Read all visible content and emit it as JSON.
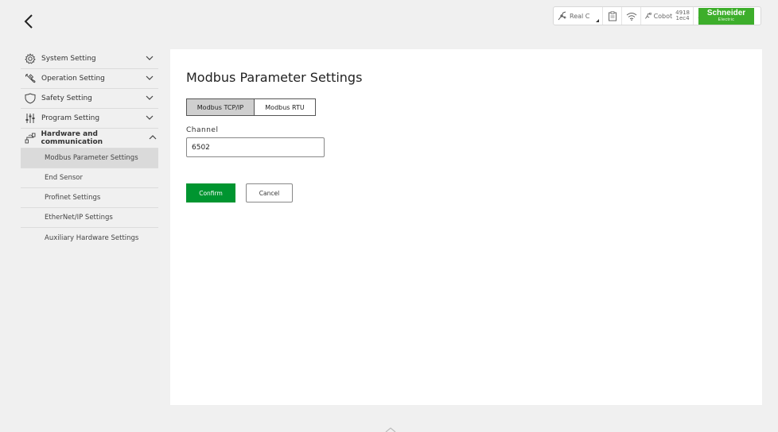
{
  "header": {
    "back_icon": "chevron-left-icon"
  },
  "status_bar": {
    "real_controller_label": "Real C",
    "cobot_label": "Cobot",
    "count_top": "4918",
    "count_bottom": "1ec4",
    "more_label": "...",
    "brand_name": "Schneider",
    "brand_sub": "Electric",
    "brand_color": "#3dae2b"
  },
  "sidebar": {
    "menus": [
      {
        "label": "System Setting",
        "icon": "gear-icon",
        "expanded": false
      },
      {
        "label": "Operation Setting",
        "icon": "wrench-icon",
        "expanded": false
      },
      {
        "label": "Safety Setting",
        "icon": "shield-icon",
        "expanded": false
      },
      {
        "label": "Program Setting",
        "icon": "sliders-icon",
        "expanded": false
      },
      {
        "label": "Hardware and communication",
        "icon": "hardware-icon",
        "expanded": true
      }
    ],
    "sub_items": [
      {
        "label": "Modbus Parameter Settings",
        "active": true
      },
      {
        "label": "End Sensor",
        "active": false
      },
      {
        "label": "Profinet Settings",
        "active": false
      },
      {
        "label": "EtherNet/IP Settings",
        "active": false
      },
      {
        "label": "Auxiliary Hardware Settings",
        "active": false
      }
    ]
  },
  "main": {
    "title": "Modbus Parameter Settings",
    "tabs": [
      {
        "label": "Modbus TCP/IP",
        "selected": true
      },
      {
        "label": "Modbus RTU",
        "selected": false
      }
    ],
    "channel_label": "Channel",
    "channel_value": "6502",
    "confirm_label": "Confirm",
    "cancel_label": "Cancel",
    "confirm_color": "#009530"
  }
}
